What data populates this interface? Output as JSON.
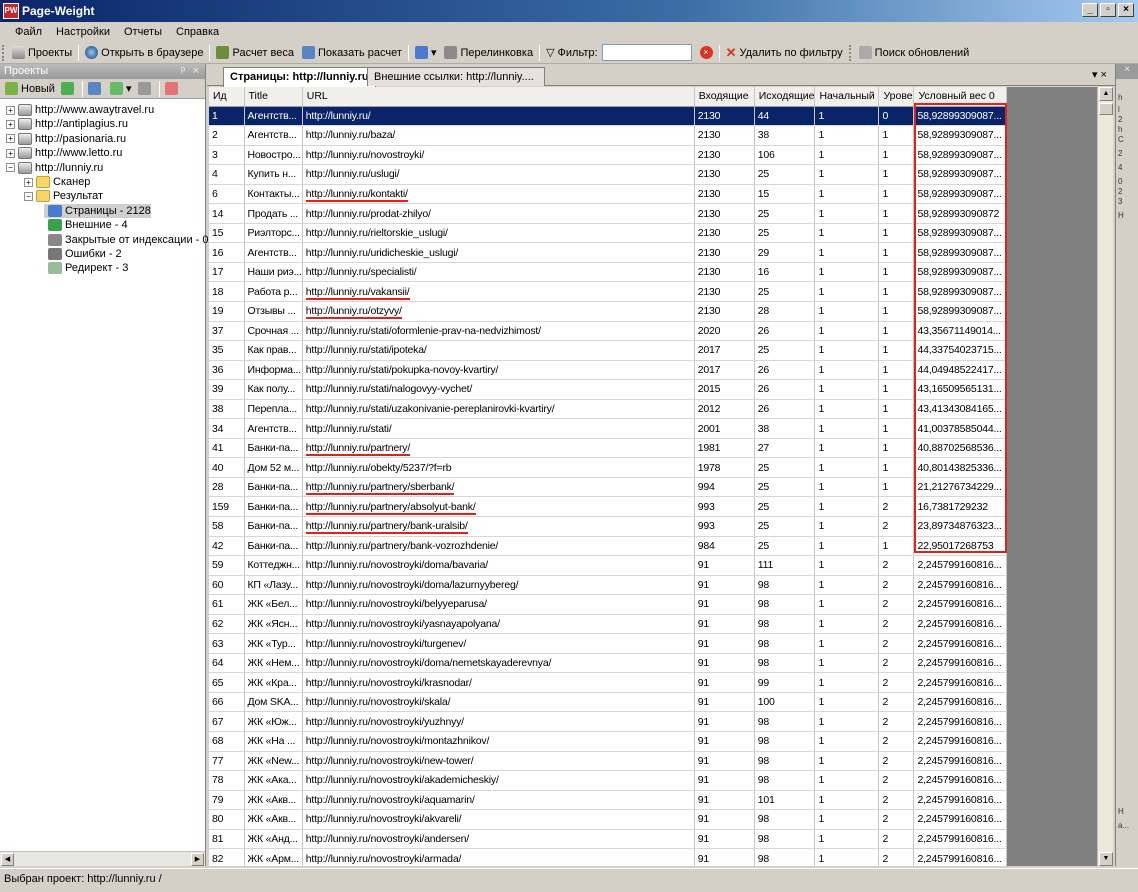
{
  "window": {
    "title": "Page-Weight",
    "app_icon": "PW",
    "controls": [
      "_",
      "▫",
      "×"
    ]
  },
  "menu": [
    "Файл",
    "Настройки",
    "Отчеты",
    "Справка"
  ],
  "toolbar": {
    "projects": "Проекты",
    "open_browser": "Открыть в браузере",
    "calc_weight": "Расчет веса",
    "show_calc": "Показать расчет",
    "relink": "Перелинковка",
    "filter": "Фильтр:",
    "filter_value": "",
    "delete_by_filter": "Удалить по фильтру",
    "check_updates": "Поиск обновлений"
  },
  "left_pane": {
    "header": "Проекты",
    "pin": "ᵖ",
    "close": "×",
    "new_button": "Новый",
    "tree": [
      {
        "label": "http://www.awaytravel.ru",
        "level": 0,
        "expander": "+",
        "icon": "server-icon"
      },
      {
        "label": "http://antiplagius.ru",
        "level": 0,
        "expander": "+",
        "icon": "server-icon"
      },
      {
        "label": "http://pasionaria.ru",
        "level": 0,
        "expander": "+",
        "icon": "server-icon"
      },
      {
        "label": "http://www.letto.ru",
        "level": 0,
        "expander": "+",
        "icon": "server-icon"
      },
      {
        "label": "http://lunniy.ru",
        "level": 0,
        "expander": "−",
        "icon": "server-icon"
      },
      {
        "label": "Сканер",
        "level": 1,
        "expander": "+",
        "icon": "folder-icon"
      },
      {
        "label": "Результат",
        "level": 1,
        "expander": "−",
        "icon": "folder-icon"
      },
      {
        "label": "Страницы - 2128",
        "level": 2,
        "expander": "",
        "icon": "pages-icon",
        "selected": true
      },
      {
        "label": "Внешние - 4",
        "level": 2,
        "expander": "",
        "icon": "globe-icon"
      },
      {
        "label": "Закрытые от индексации - 0",
        "level": 2,
        "expander": "",
        "icon": "lock-icon"
      },
      {
        "label": "Ошибки - 2",
        "level": 2,
        "expander": "",
        "icon": "error-icon"
      },
      {
        "label": "Редирект - 3",
        "level": 2,
        "expander": "",
        "icon": "redirect-icon"
      }
    ]
  },
  "tabs": [
    {
      "label": "Страницы: http://lunniy.ru",
      "active": true
    },
    {
      "label": "Внешние ссылки: http://lunniy....",
      "active": false
    }
  ],
  "tab_controls": "▾ ×",
  "grid": {
    "columns": [
      "Ид",
      "Title",
      "URL",
      "Входящие",
      "Исходящие",
      "Начальный",
      "Урове",
      "Условный вес 0"
    ],
    "rows": [
      [
        "1",
        "Агентств...",
        "http://lunniy.ru/",
        "2130",
        "44",
        "1",
        "0",
        "58,92899309087..."
      ],
      [
        "2",
        "Агентств...",
        "http://lunniy.ru/baza/",
        "2130",
        "38",
        "1",
        "1",
        "58,92899309087..."
      ],
      [
        "3",
        "Новостро...",
        "http://lunniy.ru/novostroyki/",
        "2130",
        "106",
        "1",
        "1",
        "58,92899309087..."
      ],
      [
        "4",
        "Купить н...",
        "http://lunniy.ru/uslugi/",
        "2130",
        "25",
        "1",
        "1",
        "58,92899309087..."
      ],
      [
        "6",
        "Контакты...",
        "http://lunniy.ru/kontakti/",
        "2130",
        "15",
        "1",
        "1",
        "58,92899309087..."
      ],
      [
        "14",
        "Продать ...",
        "http://lunniy.ru/prodat-zhilyo/",
        "2130",
        "25",
        "1",
        "1",
        "58,928993090872"
      ],
      [
        "15",
        "Риэлторс...",
        "http://lunniy.ru/rieltorskie_uslugi/",
        "2130",
        "25",
        "1",
        "1",
        "58,92899309087..."
      ],
      [
        "16",
        "Агентств...",
        "http://lunniy.ru/uridicheskie_uslugi/",
        "2130",
        "29",
        "1",
        "1",
        "58,92899309087..."
      ],
      [
        "17",
        "Наши риэ...",
        "http://lunniy.ru/specialisti/",
        "2130",
        "16",
        "1",
        "1",
        "58,92899309087..."
      ],
      [
        "18",
        "Работа р...",
        "http://lunniy.ru/vakansii/",
        "2130",
        "25",
        "1",
        "1",
        "58,92899309087..."
      ],
      [
        "19",
        "Отзывы ...",
        "http://lunniy.ru/otzyvy/",
        "2130",
        "28",
        "1",
        "1",
        "58,92899309087..."
      ],
      [
        "37",
        "Срочная ...",
        "http://lunniy.ru/stati/oformlenie-prav-na-nedvizhimost/",
        "2020",
        "26",
        "1",
        "1",
        "43,35671149014..."
      ],
      [
        "35",
        "Как прав...",
        "http://lunniy.ru/stati/ipoteka/",
        "2017",
        "25",
        "1",
        "1",
        "44,33754023715..."
      ],
      [
        "36",
        "Информа...",
        "http://lunniy.ru/stati/pokupka-novoy-kvartiry/",
        "2017",
        "26",
        "1",
        "1",
        "44,04948522417..."
      ],
      [
        "39",
        "Как полу...",
        "http://lunniy.ru/stati/nalogovyy-vychet/",
        "2015",
        "26",
        "1",
        "1",
        "43,16509565131..."
      ],
      [
        "38",
        "Перепла...",
        "http://lunniy.ru/stati/uzakonivanie-pereplanirovki-kvartiry/",
        "2012",
        "26",
        "1",
        "1",
        "43,41343084165..."
      ],
      [
        "34",
        "Агентств...",
        "http://lunniy.ru/stati/",
        "2001",
        "38",
        "1",
        "1",
        "41,00378585044..."
      ],
      [
        "41",
        "Банки-па...",
        "http://lunniy.ru/partnery/",
        "1981",
        "27",
        "1",
        "1",
        "40,88702568536..."
      ],
      [
        "40",
        "Дом 52 м...",
        "http://lunniy.ru/obekty/5237/?f=rb",
        "1978",
        "25",
        "1",
        "1",
        "40,80143825336..."
      ],
      [
        "28",
        "Банки-па...",
        "http://lunniy.ru/partnery/sberbank/",
        "994",
        "25",
        "1",
        "1",
        "21,21276734229..."
      ],
      [
        "159",
        "Банки-па...",
        "http://lunniy.ru/partnery/absolyut-bank/",
        "993",
        "25",
        "1",
        "2",
        "16,7381729232"
      ],
      [
        "58",
        "Банки-па...",
        "http://lunniy.ru/partnery/bank-uralsib/",
        "993",
        "25",
        "1",
        "2",
        "23,89734876323..."
      ],
      [
        "42",
        "Банки-па...",
        "http://lunniy.ru/partnery/bank-vozrozhdenie/",
        "984",
        "25",
        "1",
        "1",
        "22,95017268753"
      ],
      [
        "59",
        "Коттеджн...",
        "http://lunniy.ru/novostroyki/doma/bavaria/",
        "91",
        "111",
        "1",
        "2",
        "2,245799160816..."
      ],
      [
        "60",
        "КП «Лазу...",
        "http://lunniy.ru/novostroyki/doma/lazurnyybereg/",
        "91",
        "98",
        "1",
        "2",
        "2,245799160816..."
      ],
      [
        "61",
        "ЖК «Бел...",
        "http://lunniy.ru/novostroyki/belyyeparusa/",
        "91",
        "98",
        "1",
        "2",
        "2,245799160816..."
      ],
      [
        "62",
        "ЖК «Ясн...",
        "http://lunniy.ru/novostroyki/yasnayapolyana/",
        "91",
        "98",
        "1",
        "2",
        "2,245799160816..."
      ],
      [
        "63",
        "ЖК «Тур...",
        "http://lunniy.ru/novostroyki/turgenev/",
        "91",
        "98",
        "1",
        "2",
        "2,245799160816..."
      ],
      [
        "64",
        "ЖК «Нем...",
        "http://lunniy.ru/novostroyki/doma/nemetskayaderevnya/",
        "91",
        "98",
        "1",
        "2",
        "2,245799160816..."
      ],
      [
        "65",
        "ЖК «Кра...",
        "http://lunniy.ru/novostroyki/krasnodar/",
        "91",
        "99",
        "1",
        "2",
        "2,245799160816..."
      ],
      [
        "66",
        "Дом SKA...",
        "http://lunniy.ru/novostroyki/skala/",
        "91",
        "100",
        "1",
        "2",
        "2,245799160816..."
      ],
      [
        "67",
        "ЖК «Юж...",
        "http://lunniy.ru/novostroyki/yuzhnyy/",
        "91",
        "98",
        "1",
        "2",
        "2,245799160816..."
      ],
      [
        "68",
        "ЖК «На ...",
        "http://lunniy.ru/novostroyki/montazhnikov/",
        "91",
        "98",
        "1",
        "2",
        "2,245799160816..."
      ],
      [
        "77",
        "ЖК «New...",
        "http://lunniy.ru/novostroyki/new-tower/",
        "91",
        "98",
        "1",
        "2",
        "2,245799160816..."
      ],
      [
        "78",
        "ЖК «Ака...",
        "http://lunniy.ru/novostroyki/akademicheskiy/",
        "91",
        "98",
        "1",
        "2",
        "2,245799160816..."
      ],
      [
        "79",
        "ЖК «Акв...",
        "http://lunniy.ru/novostroyki/aquamarin/",
        "91",
        "101",
        "1",
        "2",
        "2,245799160816..."
      ],
      [
        "80",
        "ЖК «Акв...",
        "http://lunniy.ru/novostroyki/akvareli/",
        "91",
        "98",
        "1",
        "2",
        "2,245799160816..."
      ],
      [
        "81",
        "ЖК «Анд...",
        "http://lunniy.ru/novostroyki/andersen/",
        "91",
        "98",
        "1",
        "2",
        "2,245799160816..."
      ],
      [
        "82",
        "ЖК «Арм...",
        "http://lunniy.ru/novostroyki/armada/",
        "91",
        "98",
        "1",
        "2",
        "2,245799160816..."
      ]
    ],
    "underlined_rows": [
      4,
      9,
      10,
      17,
      19,
      20,
      21
    ],
    "selected_row": 0,
    "highlight_color": "#e32119"
  },
  "right_edge": {
    "header": "×",
    "snippets": [
      "h",
      "l",
      "2",
      "h",
      "C",
      "2",
      "4",
      "0",
      "2",
      "3",
      "H",
      "H",
      "а..."
    ]
  },
  "status": "Выбран проект: http://lunniy.ru /"
}
